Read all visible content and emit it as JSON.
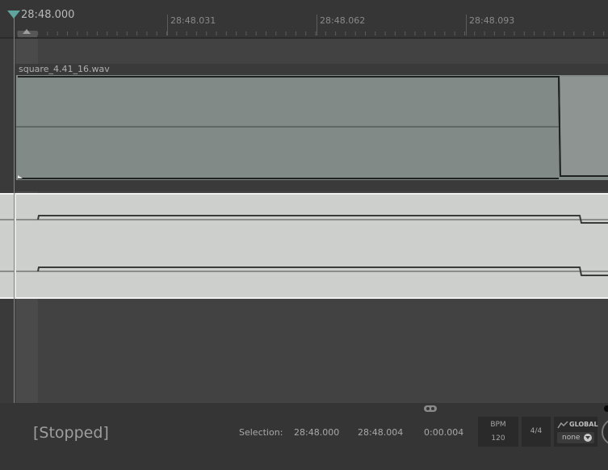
{
  "ruler": {
    "playhead_time": "28:48.000",
    "ticks": [
      {
        "label": "28:48.031"
      },
      {
        "label": "28:48.062"
      },
      {
        "label": "28:48.093"
      }
    ]
  },
  "audio_clip": {
    "name": "square_4.41_16.wav"
  },
  "status": {
    "transport": "[Stopped]",
    "selection_label": "Selection:",
    "selection_start": "28:48.000",
    "selection_end": "28:48.004",
    "selection_length": "0:00.004"
  },
  "tempo": {
    "bpm_label": "BPM",
    "bpm_value": "120"
  },
  "meter": {
    "value": "4/4"
  },
  "global": {
    "label": "GLOBAL",
    "value": "none"
  },
  "colors": {
    "playhead": "#5fa59d",
    "clip": "#828a87",
    "midi_track": "#cdcfcd"
  }
}
